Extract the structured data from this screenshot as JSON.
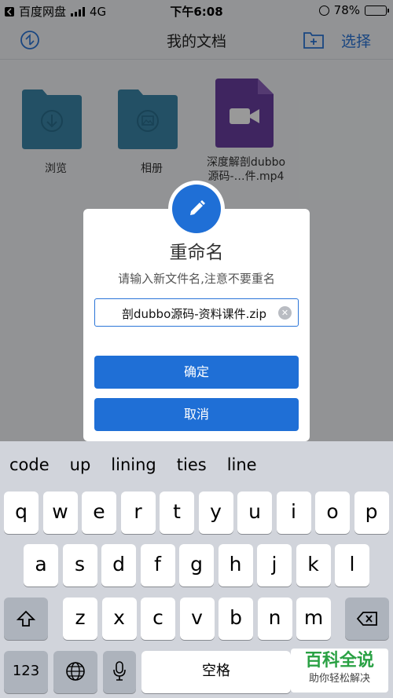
{
  "status": {
    "carrier": "百度网盘",
    "network": "4G",
    "time": "下午6:08",
    "battery": "78%",
    "battery_level": 0.78
  },
  "nav": {
    "title": "我的文档",
    "select": "选择"
  },
  "files": [
    {
      "label": "浏览"
    },
    {
      "label": "相册"
    },
    {
      "label_line1": "深度解剖dubbo",
      "label_line2": "源码-…件.mp4"
    }
  ],
  "dialog": {
    "title": "重命名",
    "hint": "请输入新文件名,注意不要重名",
    "input_value": "剖dubbo源码-资料课件.zip",
    "confirm": "确定",
    "cancel": "取消"
  },
  "keyboard": {
    "predictions": [
      "code",
      "up",
      "lining",
      "ties",
      "line"
    ],
    "row1": [
      "q",
      "w",
      "e",
      "r",
      "t",
      "y",
      "u",
      "i",
      "o",
      "p"
    ],
    "row2": [
      "a",
      "s",
      "d",
      "f",
      "g",
      "h",
      "j",
      "k",
      "l"
    ],
    "row3": [
      "z",
      "x",
      "c",
      "v",
      "b",
      "n",
      "m"
    ],
    "numbers": "123",
    "space": "空格"
  },
  "watermark": {
    "title": "百科全说",
    "subtitle": "助你轻松解决"
  },
  "colors": {
    "accent": "#1f6fd6",
    "folder": "#3b86a8",
    "video": "#6a3fa0"
  }
}
